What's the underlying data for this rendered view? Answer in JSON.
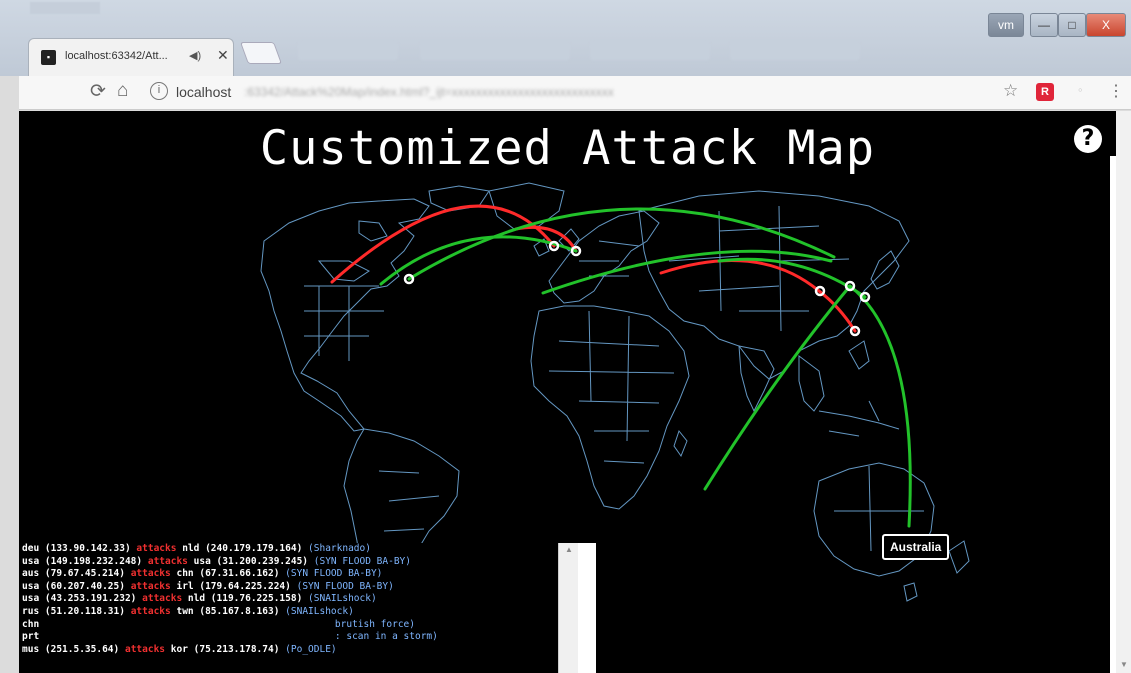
{
  "browser": {
    "tab_title": "localhost:63342/Att...",
    "tab_audio": "◀)",
    "tab_close": "✕",
    "url_host": "localhost",
    "window_user": "vm",
    "window_minimize": "—",
    "window_maximize": "□",
    "window_close": "X",
    "ext_label": "R"
  },
  "page": {
    "title": "Customized Attack Map",
    "help": "?",
    "country_label": "Australia"
  },
  "attack_log": [
    {
      "src": "deu (133.90.142.33)",
      "verb": "attacks",
      "dst": "nld (240.179.179.164)",
      "type": "(Sharknado)"
    },
    {
      "src": "usa (149.198.232.248)",
      "verb": "attacks",
      "dst": "usa (31.200.239.245)",
      "type": "(SYN FLOOD BA-BY)"
    },
    {
      "src": "aus (79.67.45.214)",
      "verb": "attacks",
      "dst": "chn (67.31.66.162)",
      "type": "(SYN FLOOD BA-BY)"
    },
    {
      "src": "usa (60.207.40.25)",
      "verb": "attacks",
      "dst": "irl (179.64.225.224)",
      "type": "(SYN FLOOD BA-BY)"
    },
    {
      "src": "usa (43.253.191.232)",
      "verb": "attacks",
      "dst": "nld (119.76.225.158)",
      "type": "(SNAILshock)"
    },
    {
      "src": "rus (51.20.118.31)",
      "verb": "attacks",
      "dst": "twn (85.167.8.163)",
      "type": "(SNAILshock)"
    },
    {
      "src": "chn",
      "verb": "",
      "dst": "",
      "type": "brutish force)"
    },
    {
      "src": "prt",
      "verb": "",
      "dst": "",
      "type": ": scan in a storm)"
    },
    {
      "src": "mus (251.5.35.64)",
      "verb": "attacks",
      "dst": "kor (75.213.178.74)",
      "type": "(Po_ODLE)"
    }
  ],
  "colors": {
    "attack_red": "#ff2a2a",
    "attack_green": "#22c22a",
    "coastline": "#6fa8d8",
    "background": "#000000"
  }
}
